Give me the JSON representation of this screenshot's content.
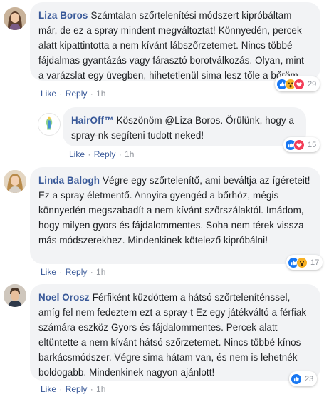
{
  "comments": [
    {
      "author": "Liza Boros",
      "text": "Számtalan szőrtelenítési módszert kipróbáltam már, de ez a spray mindent megváltoztat! Könnyedén, percek alatt kipattintotta a nem kívánt lábszőrzetemet. Nincs többé fájdalmas gyantázás vagy fárasztó borotválkozás. Olyan, mint a varázslat egy üvegben, hihetetlenül sima lesz tőle a bőröm.",
      "like": "Like",
      "reply": "Reply",
      "time": "1h",
      "reaction_count": "29",
      "reactions": [
        "like-icon",
        "wow-icon",
        "love-icon"
      ]
    },
    {
      "author": "HairOff™",
      "text": "Köszönöm @Liza Boros. Örülünk, hogy a spray-nk segíteni tudott neked!",
      "like": "Like",
      "reply": "Reply",
      "time": "1h",
      "reaction_count": "15",
      "reactions": [
        "like-icon",
        "love-icon"
      ]
    },
    {
      "author": "Linda Balogh",
      "text": "Végre egy szőrtelenítő, ami beváltja az ígéreteit! Ez a spray életmentő. Annyira gyengéd a bőrhöz, mégis könnyedén megszabadít a nem kívánt szőrszálaktól. Imádom, hogy milyen gyors és fájdalommentes. Soha nem térek vissza más módszerekhez. Mindenkinek kötelező kipróbálni!",
      "like": "Like",
      "reply": "Reply",
      "time": "1h",
      "reaction_count": "17",
      "reactions": [
        "like-icon",
        "wow-icon"
      ]
    },
    {
      "author": "Noel Orosz",
      "text": "Férfiként küzdöttem a hátsó szőrteleníténssel, amíg fel nem fedeztem ezt a spray-t Ez egy játékváltó a férfiak számára eszköz Gyors és fájdalommentes. Percek alatt eltüntette a nem kívánt hátsó szőrzetemet. Nincs többé kínos barkácsmódszer. Végre sima hátam van, és nem is lehetnék boldogabb. Mindenkinek nagyon ajánlott!",
      "like": "Like",
      "reply": "Reply",
      "time": "1h",
      "reaction_count": "23",
      "reactions": [
        "like-icon"
      ]
    }
  ],
  "colors": {
    "link": "#385898",
    "bubble": "#f2f3f5",
    "like": "#1877f2",
    "love": "#f33e58",
    "wow": "#f7b125"
  }
}
